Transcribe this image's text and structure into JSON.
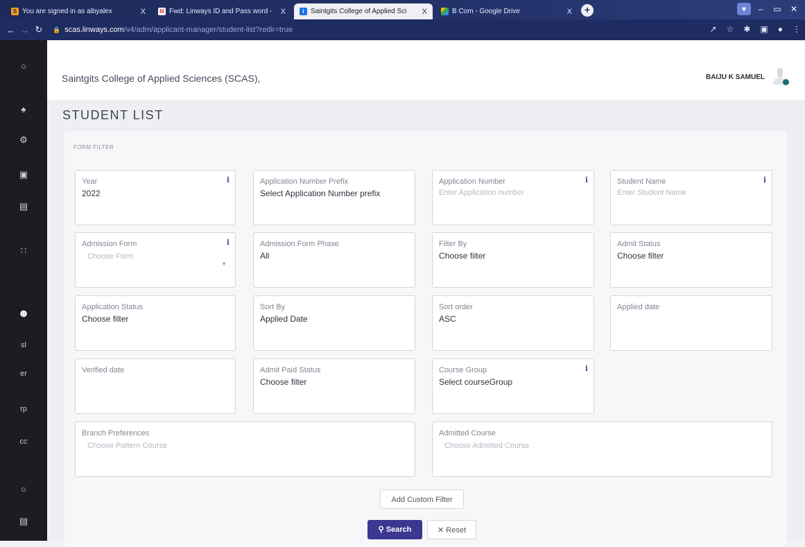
{
  "browser": {
    "tabs": [
      {
        "label": "You are signed in as albyalex",
        "favicon": "S"
      },
      {
        "label": "Fwd: Linways ID and Pass word -",
        "favicon": "M"
      },
      {
        "label": "Saintgits College of Applied Sci",
        "favicon": "i"
      },
      {
        "label": "B Com - Google Drive",
        "favicon": "drive"
      }
    ],
    "close_glyph": "X",
    "new_tab": "+",
    "url_host": "scas.linways.com",
    "url_path": "/v4/adm/applicant-manager/student-list?redir=true"
  },
  "sidebar": {
    "items": [
      "sl",
      "er",
      "rp",
      "cc"
    ]
  },
  "header": {
    "institution": "Saintgits College of Applied Sciences (SCAS),",
    "user_name": "BAIJU K SAMUEL"
  },
  "page": {
    "title": "STUDENT LIST",
    "filter_label": "FORM FILTER"
  },
  "filters": {
    "year": {
      "label": "Year",
      "value": "2022"
    },
    "app_prefix": {
      "label": "Application Number Prefix",
      "value": "Select Application Number prefix"
    },
    "app_number": {
      "label": "Application Number",
      "placeholder": "Enter Application number"
    },
    "student_name": {
      "label": "Student Name",
      "placeholder": "Enter Student Name"
    },
    "admission_form": {
      "label": "Admission Form",
      "placeholder": "Choose Form"
    },
    "admission_phase": {
      "label": "Admission Form Phase",
      "value": "All"
    },
    "filter_by": {
      "label": "Filter By",
      "value": "Choose filter"
    },
    "admit_status": {
      "label": "Admit Status",
      "value": "Choose filter"
    },
    "app_status": {
      "label": "Application Status",
      "value": "Choose filter"
    },
    "sort_by": {
      "label": "Sort By",
      "value": "Applied Date"
    },
    "sort_order": {
      "label": "Sort order",
      "value": "ASC"
    },
    "applied_date": {
      "label": "Applied date"
    },
    "verified_date": {
      "label": "Verified date"
    },
    "admit_paid_status": {
      "label": "Admit Paid Status",
      "value": "Choose filter"
    },
    "course_group": {
      "label": "Course Group",
      "value": "Select courseGroup"
    },
    "branch_prefs": {
      "label": "Branch Preferences",
      "placeholder": "Choose Pattern Course"
    },
    "admitted_course": {
      "label": "Admitted Course",
      "placeholder": "Choose Admitted Course"
    }
  },
  "actions": {
    "custom_filter": "Add Custom Filter",
    "search": "Search",
    "reset": "Reset"
  },
  "colors": {
    "accent": "#3c3791",
    "sidebar_bg": "#1c1c22",
    "browser_bg": "#1e2c62"
  }
}
